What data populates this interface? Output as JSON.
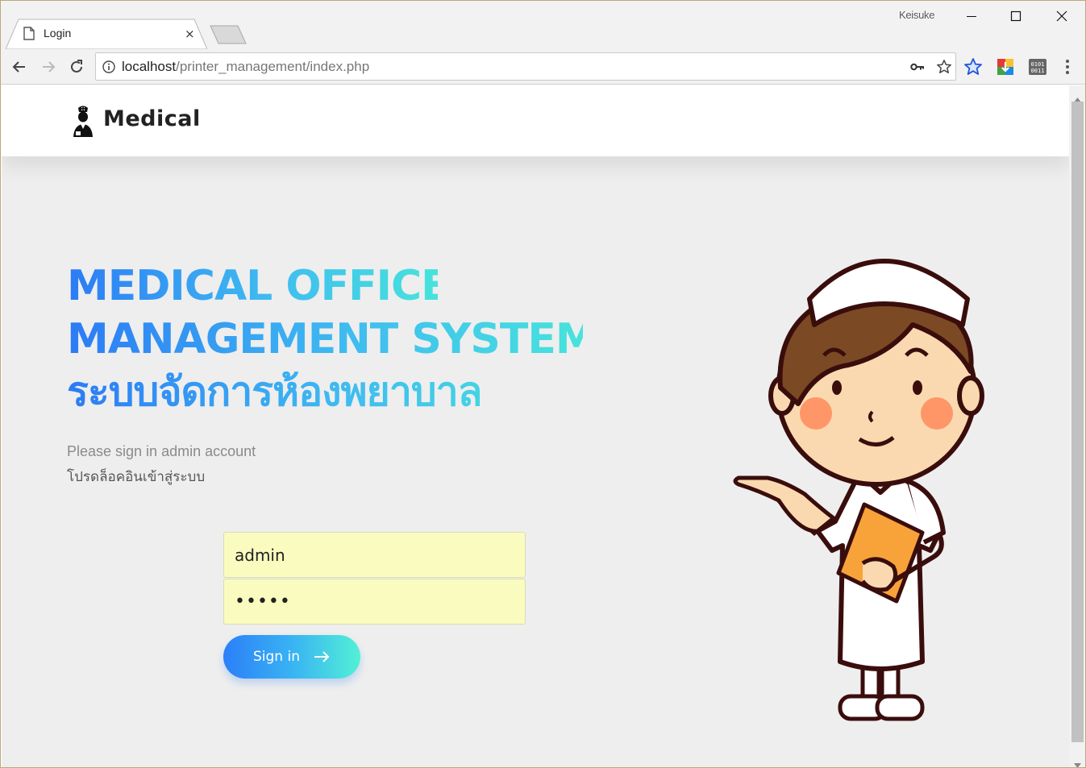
{
  "browser": {
    "tab_title": "Login",
    "tab_close": "×",
    "profile_name": "Keisuke",
    "url_host": "localhost",
    "url_path": "/printer_management/index.php"
  },
  "icons": {
    "tab": "document-icon",
    "back": "arrow-left-icon",
    "forward": "arrow-right-icon",
    "reload": "reload-icon",
    "info": "info-icon",
    "key": "key-icon",
    "bookmark": "star-icon",
    "menu": "kebab-menu-icon"
  },
  "site": {
    "brand": "Medical",
    "title_line1": "MEDICAL OFFICE",
    "title_line2": "MANAGEMENT SYSTEM",
    "title_line3": "ระบบจัดการห้องพยาบาล",
    "subtitle_en": "Please sign in admin account",
    "subtitle_th": "โปรดล็อคอินเข้าสู่ระบบ"
  },
  "form": {
    "username_value": "admin",
    "password_masked": "•••••",
    "signin_label": "Sign in"
  },
  "colors": {
    "gradient_start": "#2c7bf5",
    "gradient_end": "#47e3dc",
    "input_bg": "#f9fcbe",
    "page_bg": "#eeeeee"
  }
}
